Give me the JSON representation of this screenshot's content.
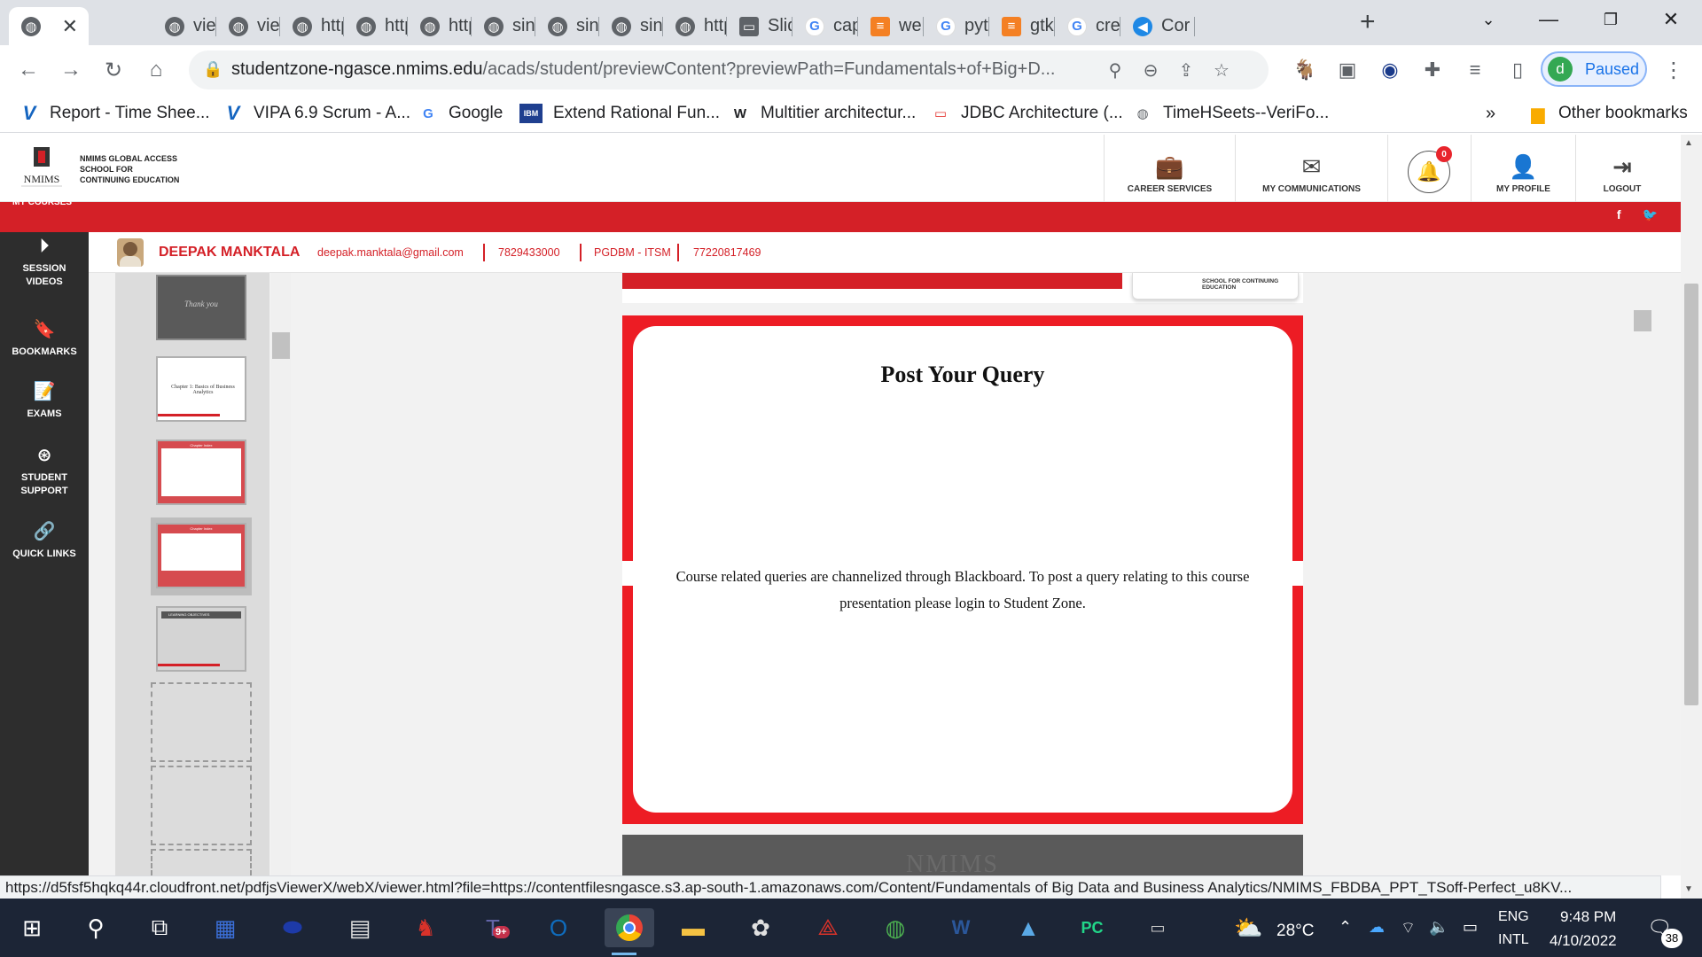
{
  "browser": {
    "tabs": [
      {
        "title": "",
        "icon": "globe-icon"
      },
      {
        "title": "viev",
        "icon": "globe-icon"
      },
      {
        "title": "viev",
        "icon": "globe-icon"
      },
      {
        "title": "http",
        "icon": "globe-icon"
      },
      {
        "title": "http",
        "icon": "globe-icon"
      },
      {
        "title": "http",
        "icon": "globe-icon"
      },
      {
        "title": "sinc",
        "icon": "globe-icon"
      },
      {
        "title": "sinc",
        "icon": "globe-icon"
      },
      {
        "title": "sinc",
        "icon": "globe-icon"
      },
      {
        "title": "http",
        "icon": "globe-icon"
      },
      {
        "title": "Slid",
        "icon": "slides-icon"
      },
      {
        "title": "cap",
        "icon": "google-icon"
      },
      {
        "title": "wel",
        "icon": "stackoverflow-icon"
      },
      {
        "title": "pytl",
        "icon": "google-icon"
      },
      {
        "title": "gtk",
        "icon": "stackoverflow-icon"
      },
      {
        "title": "crea",
        "icon": "google-icon"
      },
      {
        "title": "Cor",
        "icon": "fish-icon"
      }
    ],
    "url_host": "studentzone-ngasce.nmims.edu",
    "url_path": "/acads/student/previewContent?previewPath=Fundamentals+of+Big+D...",
    "profile_initial": "d",
    "profile_status": "Paused",
    "bookmarks": [
      {
        "label": "Report - Time Shee...",
        "icon": "vipa-icon"
      },
      {
        "label": "VIPA 6.9 Scrum - A...",
        "icon": "vipa-icon"
      },
      {
        "label": "Google",
        "icon": "google-icon"
      },
      {
        "label": "Extend Rational Fun...",
        "icon": "ibm-icon"
      },
      {
        "label": "Multitier architectur...",
        "icon": "wikipedia-icon"
      },
      {
        "label": "JDBC Architecture (...",
        "icon": "oracle-icon"
      },
      {
        "label": "TimeHSeets--VeriFo...",
        "icon": "globe-icon"
      }
    ],
    "bookmarks_overflow": "»",
    "other_bookmarks": "Other bookmarks",
    "status_url": "https://d5fsf5hqkq44r.cloudfront.net/pdfjsViewerX/webX/viewer.html?file=https://contentfilesngasce.s3.ap-south-1.amazonaws.com/Content/Fundamentals of Big Data and Business Analytics/NMIMS_FBDBA_PPT_TSoff-Perfect_u8KV..."
  },
  "site": {
    "logo_brand": "NMIMS",
    "logo_line1": "NMIMS GLOBAL ACCESS",
    "logo_line2": "SCHOOL FOR",
    "logo_line3": "CONTINUING EDUCATION",
    "nav": {
      "career": "CAREER SERVICES",
      "communications": "MY COMMUNICATIONS",
      "notifications_count": "0",
      "profile": "MY PROFILE",
      "logout": "LOGOUT"
    },
    "my_courses": "MY COURSES",
    "social": {
      "facebook": "f",
      "twitter": "🐦"
    },
    "sidebar": [
      {
        "label": "SESSION VIDEOS",
        "icon": "play-icon"
      },
      {
        "label": "BOOKMARKS",
        "icon": "bookmark-icon"
      },
      {
        "label": "EXAMS",
        "icon": "exam-icon"
      },
      {
        "label": "STUDENT SUPPORT",
        "icon": "support-icon"
      },
      {
        "label": "QUICK LINKS",
        "icon": "link-icon"
      }
    ],
    "student": {
      "name": "DEEPAK MANKTALA",
      "email": "deepak.manktala@gmail.com",
      "phone": "7829433000",
      "program": "PGDBM - ITSM",
      "sapid": "77220817469"
    }
  },
  "viewer": {
    "thumbnails": [
      {
        "label": "Thank you"
      },
      {
        "label": "Chapter 1: Basics of Business Analytics"
      },
      {
        "label": "Chapter Index"
      },
      {
        "label": "Chapter Index"
      },
      {
        "label": "LEARNING OBJECTIVES"
      }
    ],
    "slide_top_logo": "SCHOOL FOR CONTINUING EDUCATION",
    "slide_title": "Post Your Query",
    "slide_body": "Course related queries are channelized through Blackboard. To post a query relating to this course presentation please login to Student Zone.",
    "next_slide_watermark": "NMIMS"
  },
  "taskbar": {
    "apps": [
      "start-icon",
      "search-icon",
      "task-view-icon",
      "calculator-icon",
      "app-icon",
      "notepad-icon",
      "git-icon",
      "teams-icon",
      "outlook-icon",
      "chrome-icon",
      "file-explorer-icon",
      "paint-icon",
      "acrobat-icon",
      "globe-icon",
      "word-icon",
      "photos-icon",
      "pycharm-icon",
      "terminal-icon"
    ],
    "teams_badge": "9+",
    "weather": "28°C",
    "lang_top": "ENG",
    "lang_bottom": "INTL",
    "time": "9:48 PM",
    "date": "4/10/2022",
    "notifications": "38"
  }
}
